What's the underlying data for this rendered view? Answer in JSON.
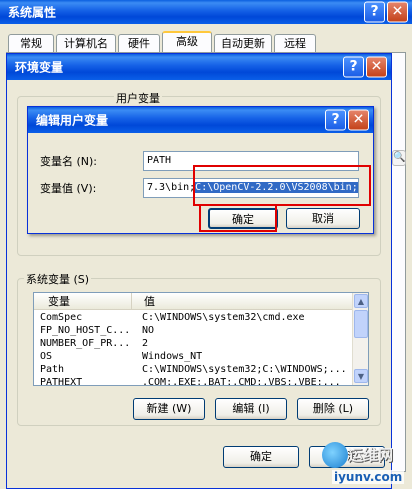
{
  "outer": {
    "title": "系统属性",
    "help": "?",
    "close": "✕"
  },
  "tabs": [
    "常规",
    "计算机名",
    "硬件",
    "高级",
    "自动更新",
    "远程"
  ],
  "env": {
    "title": "环境变量",
    "help": "?",
    "close": "✕",
    "user_group_label": "用户变量",
    "sys_group_label": "系统变量 (S)",
    "col_var": "变量",
    "col_val": "值",
    "rows": [
      {
        "var": "ComSpec",
        "val": "C:\\WINDOWS\\system32\\cmd.exe"
      },
      {
        "var": "FP_NO_HOST_C...",
        "val": "NO"
      },
      {
        "var": "NUMBER_OF_PR...",
        "val": "2"
      },
      {
        "var": "OS",
        "val": "Windows_NT"
      },
      {
        "var": "Path",
        "val": "C:\\WINDOWS\\system32;C:\\WINDOWS;..."
      },
      {
        "var": "PATHEXT",
        "val": ".COM;.EXE;.BAT;.CMD;.VBS;.VBE;..."
      }
    ],
    "new_btn": "新建 (W)",
    "edit_btn": "编辑 (I)",
    "del_btn": "删除 (L)",
    "ok_btn": "确定",
    "cancel_btn": "取消"
  },
  "edit": {
    "title": "编辑用户变量",
    "help": "?",
    "close": "✕",
    "name_label": "变量名 (N):",
    "name_value": "PATH",
    "value_label": "变量值 (V):",
    "value_prefix": "7.3\\bin;",
    "value_selected": "C:\\OpenCV-2.2.0\\VS2008\\bin;",
    "ok_btn": "确定",
    "cancel_btn": "取消"
  },
  "watermark": {
    "brand": "运维网",
    "url": "iyunv.com"
  },
  "colors": {
    "highlight": "#e00000",
    "title_blue": "#0a5fe0",
    "selection": "#316ac5"
  }
}
